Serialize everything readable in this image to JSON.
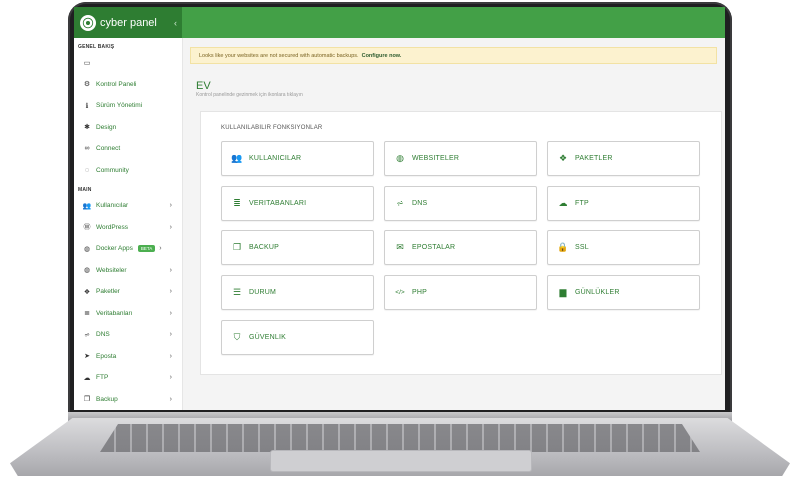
{
  "brand": {
    "name": "cyber panel",
    "logo_glyph": "⦿",
    "collapse_icon": "‹"
  },
  "sidebar": {
    "section_general": "GENEL BAKIŞ",
    "general_items": [
      {
        "label": "",
        "icon": "monitor-icon",
        "glyph": "▭"
      },
      {
        "label": "Kontrol Paneli",
        "icon": "dashboard-icon",
        "glyph": "⚙"
      },
      {
        "label": "Sürüm Yönetimi",
        "icon": "info-icon",
        "glyph": "ℹ"
      },
      {
        "label": "Design",
        "icon": "cog-icon",
        "glyph": "✱"
      },
      {
        "label": "Connect",
        "icon": "link-icon",
        "glyph": "∞"
      },
      {
        "label": "Community",
        "icon": "chat-icon",
        "glyph": "◌"
      }
    ],
    "section_main": "MAIN",
    "main_items": [
      {
        "label": "Kullanıcılar",
        "icon": "users-icon",
        "glyph": "👥",
        "arrow": "›"
      },
      {
        "label": "WordPress",
        "icon": "wordpress-icon",
        "glyph": "Ⓦ",
        "arrow": "›"
      },
      {
        "label": "Docker Apps",
        "icon": "docker-icon",
        "glyph": "◍",
        "arrow": "›",
        "badge": "BETA"
      },
      {
        "label": "Websiteler",
        "icon": "globe-icon",
        "glyph": "◍",
        "arrow": "›"
      },
      {
        "label": "Paketler",
        "icon": "packages-icon",
        "glyph": "❖",
        "arrow": "›"
      },
      {
        "label": "Veritabanları",
        "icon": "database-icon",
        "glyph": "≣",
        "arrow": "›"
      },
      {
        "label": "DNS",
        "icon": "sitemap-icon",
        "glyph": "⩫",
        "arrow": "›"
      },
      {
        "label": "Eposta",
        "icon": "paper-plane-icon",
        "glyph": "➤",
        "arrow": "›"
      },
      {
        "label": "FTP",
        "icon": "cloud-upload-icon",
        "glyph": "☁",
        "arrow": "›"
      },
      {
        "label": "Backup",
        "icon": "copy-icon",
        "glyph": "❐",
        "arrow": "›"
      }
    ]
  },
  "alert": {
    "text": "Looks like your websites are not secured with automatic backups.",
    "link": "Configure now."
  },
  "page": {
    "title": "EV",
    "subtitle": "Kontrol panelinde gezinmek için ikonlara tıklayın"
  },
  "functions": {
    "title": "KULLANILABILIR FONKSIYONLAR",
    "items": [
      {
        "label": "KULLANICILAR",
        "icon": "users-icon",
        "glyph": "👥"
      },
      {
        "label": "WEBSITELER",
        "icon": "globe-icon",
        "glyph": "◍"
      },
      {
        "label": "PAKETLER",
        "icon": "packages-icon",
        "glyph": "❖"
      },
      {
        "label": "VERITABANLARI",
        "icon": "database-icon",
        "glyph": "≣"
      },
      {
        "label": "DNS",
        "icon": "sitemap-icon",
        "glyph": "⩫"
      },
      {
        "label": "FTP",
        "icon": "cloud-upload-icon",
        "glyph": "☁"
      },
      {
        "label": "BACKUP",
        "icon": "copy-icon",
        "glyph": "❐"
      },
      {
        "label": "EPOSTALAR",
        "icon": "envelope-icon",
        "glyph": "✉"
      },
      {
        "label": "SSL",
        "icon": "lock-icon",
        "glyph": "🔒"
      },
      {
        "label": "DURUM",
        "icon": "server-icon",
        "glyph": "☰"
      },
      {
        "label": "PHP",
        "icon": "code-icon",
        "glyph": "</>"
      },
      {
        "label": "GÜNLÜKLER",
        "icon": "file-icon",
        "glyph": "▆"
      },
      {
        "label": "GÜVENLIK",
        "icon": "shield-icon",
        "glyph": "⛉"
      }
    ]
  },
  "colors": {
    "primary": "#2e7d32",
    "topbar": "#43a047",
    "alert_bg": "#fcf2cf"
  }
}
